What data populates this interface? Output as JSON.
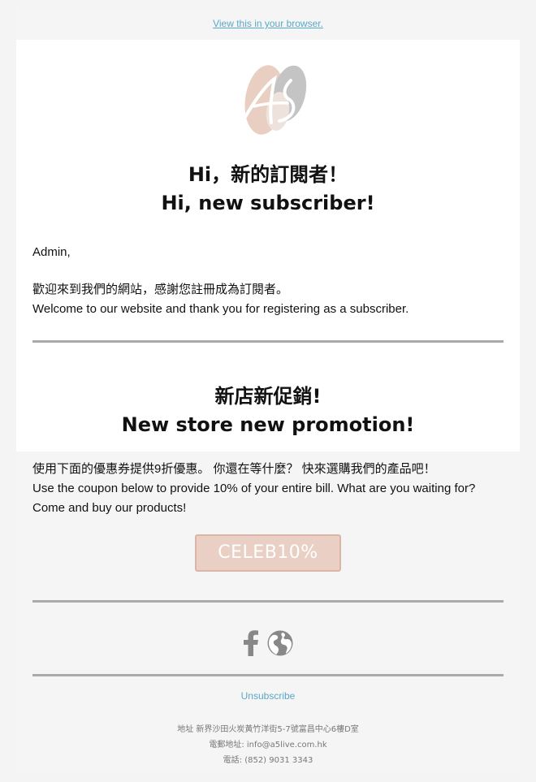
{
  "header": {
    "browser_link": "View this in your browser."
  },
  "hero": {
    "logo_alt": "A5 logo",
    "title_zh": "Hi，新的訂閱者！",
    "title_en": "Hi, new subscriber!"
  },
  "intro": {
    "greeting": "Admin,",
    "welcome_zh": "歡迎來到我們的網站，感謝您註冊成為訂閱者。",
    "welcome_en": "Welcome to our website and thank you for registering as a subscriber."
  },
  "promo": {
    "title_zh": "新店新促銷!",
    "title_en": "New store new promotion!",
    "text_zh": "使用下面的優惠券提供9折優惠。 你還在等什麼？ 快來選購我們的產品吧！",
    "text_en": "Use the coupon below to provide 10% of your entire bill. What are you waiting for? Come and buy our products!",
    "coupon_code": "CELEB10%"
  },
  "social": {
    "facebook": "facebook-icon",
    "website": "globe-icon"
  },
  "footer": {
    "unsubscribe": "Unsubscribe",
    "address": "地址 新界沙田火炭黃竹洋街5-7號富昌中心6樓D室",
    "email": "電郵地址: info@a5live.com.hk",
    "phone": "電話: (852) 9031 3343"
  },
  "colors": {
    "link": "#5aa8c8",
    "coupon_bg": "#e9cfc4",
    "divider": "#aaaaaa"
  }
}
